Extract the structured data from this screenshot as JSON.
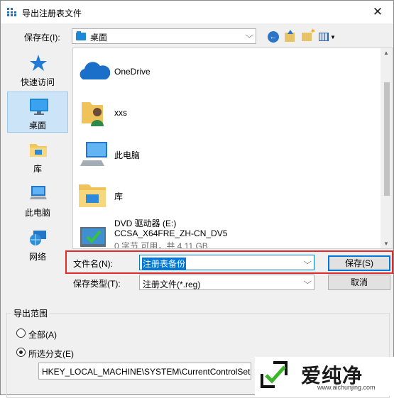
{
  "window": {
    "title": "导出注册表文件",
    "close_glyph": "✕"
  },
  "location": {
    "label": "保存在(I):",
    "value": "桌面"
  },
  "nav": [
    {
      "label": "快速访问",
      "icon": "star-pin-icon"
    },
    {
      "label": "桌面",
      "icon": "desktop-icon",
      "selected": true
    },
    {
      "label": "库",
      "icon": "library-folder-icon"
    },
    {
      "label": "此电脑",
      "icon": "computer-icon"
    },
    {
      "label": "网络",
      "icon": "network-globe-icon"
    }
  ],
  "files": [
    {
      "name": "OneDrive",
      "icon": "cloud-icon"
    },
    {
      "name": "xxs",
      "icon": "user-folder-icon"
    },
    {
      "name": "此电脑",
      "icon": "computer-icon"
    },
    {
      "name": "库",
      "icon": "library-folder-icon"
    },
    {
      "name": "DVD 驱动器 (E:)",
      "volume": "CCSA_X64FRE_ZH-CN_DV5",
      "space": "0 字节 可用，共 4.11 GB",
      "icon": "dvd-drive-icon"
    }
  ],
  "filename": {
    "label": "文件名(N):",
    "value": "注册表备份"
  },
  "filetype": {
    "label": "保存类型(T):",
    "value": "注册文件(*.reg)"
  },
  "buttons": {
    "save": "保存(S)",
    "cancel": "取消"
  },
  "export_range": {
    "title": "导出范围",
    "options": [
      {
        "label": "全部(A)",
        "checked": false
      },
      {
        "label": "所选分支(E)",
        "checked": true
      }
    ],
    "branch_path": "HKEY_LOCAL_MACHINE\\SYSTEM\\CurrentControlSet"
  },
  "watermark": {
    "text": "爱纯净",
    "url": "www.aichunjing.com"
  },
  "colors": {
    "accent": "#0078d7",
    "highlight_border": "#e22a2a",
    "selection": "#cce4f7"
  }
}
